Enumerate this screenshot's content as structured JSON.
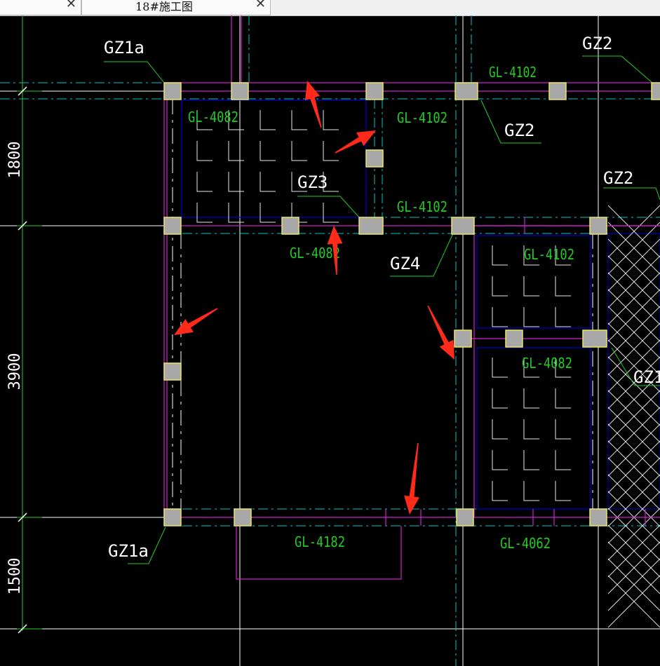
{
  "tabs": [
    {
      "label": ""
    },
    {
      "label": "18#施工图"
    }
  ],
  "close_glyph": "✕",
  "dimensions": [
    "1800",
    "3900",
    "1500"
  ],
  "column_labels": [
    "GZ1a",
    "GZ2",
    "GZ2",
    "GZ2",
    "GZ3",
    "GZ4",
    "GZ1",
    "GZ1a"
  ],
  "beam_labels": [
    "GL-4082",
    "GL-4102",
    "GL-4102",
    "GL-4102",
    "GL-4082",
    "GL-4102",
    "GL-4082",
    "GL-4182",
    "GL-4062"
  ],
  "colors": {
    "grid": "#ffffff",
    "axis": "#00c8c8",
    "wall": "#d020d0",
    "column_fill": "#a8a8a8",
    "column_edge": "#e8e860",
    "slab": "#0000cc",
    "text": "#22cc22",
    "arrow": "#ff2a1a"
  }
}
